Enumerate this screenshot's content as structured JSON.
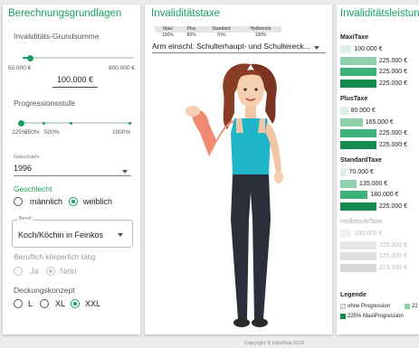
{
  "left": {
    "title": "Berechnungsgrundlagen",
    "sum_label": "Invaliditäts-Grundsumme",
    "sum_min": "50.000 €",
    "sum_max": "800.000 €",
    "sum_value": "100.000 €",
    "sum_fraction": 0.067,
    "prog_label": "Progressionsstufe",
    "prog_ticks": [
      "225%",
      "350%",
      "500%",
      "1000%"
    ],
    "prog_fraction": 0.0,
    "birth_label": "Geburtsjahr",
    "birth_value": "1996",
    "gender_head": "Geschlecht",
    "gender_male": "männlich",
    "gender_female": "weiblich",
    "job_label": "Beruf",
    "job_value": "Koch/Köchin in Feinkos",
    "physical_label": "Beruflich körperlich tätig",
    "physical_yes": "Ja",
    "physical_no": "Nein",
    "concept_label": "Deckungskonzept",
    "concept_l": "L",
    "concept_xl": "XL",
    "concept_xxl": "XXL"
  },
  "mid": {
    "title": "Invaliditätstaxe",
    "table_headers": [
      "Maxi",
      "Plus",
      "Standard",
      "Heilberufe"
    ],
    "table_values": [
      "100%",
      "80%",
      "70%",
      "100%"
    ],
    "select_value": "Arm einschl. Schulterhaupt- und Schultereck..."
  },
  "right": {
    "title": "Invaliditätsleistung",
    "groups": [
      {
        "name": "MaxiTaxe",
        "disabled": false,
        "bars": [
          {
            "label": "100.000 €",
            "fraction": 0.13,
            "color": "#dcf0e4"
          },
          {
            "label": "225.000 €",
            "fraction": 0.42,
            "color": "#8fd1ad"
          },
          {
            "label": "225.000 €",
            "fraction": 0.42,
            "color": "#3bb37a"
          },
          {
            "label": "225.000 €",
            "fraction": 0.42,
            "color": "#138a4e"
          }
        ]
      },
      {
        "name": "PlusTaxe",
        "disabled": false,
        "bars": [
          {
            "label": "80.000 €",
            "fraction": 0.09,
            "color": "#dcf0e4"
          },
          {
            "label": "165.000 €",
            "fraction": 0.26,
            "color": "#8fd1ad"
          },
          {
            "label": "225.000 €",
            "fraction": 0.42,
            "color": "#3bb37a"
          },
          {
            "label": "225.000 €",
            "fraction": 0.42,
            "color": "#138a4e"
          }
        ]
      },
      {
        "name": "StandardTaxe",
        "disabled": false,
        "bars": [
          {
            "label": "70.000 €",
            "fraction": 0.07,
            "color": "#dcf0e4"
          },
          {
            "label": "135.000 €",
            "fraction": 0.19,
            "color": "#8fd1ad"
          },
          {
            "label": "180.000 €",
            "fraction": 0.32,
            "color": "#3bb37a"
          },
          {
            "label": "225.000 €",
            "fraction": 0.42,
            "color": "#138a4e"
          }
        ]
      },
      {
        "name": "HeilberufeTaxe",
        "disabled": true,
        "bars": [
          {
            "label": "100.000 €",
            "fraction": 0.13,
            "color": "#f0f0f0"
          },
          {
            "label": "225.000 €",
            "fraction": 0.42,
            "color": "#e6e6e6"
          },
          {
            "label": "225.000 €",
            "fraction": 0.42,
            "color": "#dedede"
          },
          {
            "label": "225.000 €",
            "fraction": 0.42,
            "color": "#d6d6d6"
          }
        ]
      }
    ],
    "legend_head": "Legende",
    "legend_items": [
      {
        "label": "ohne Progression",
        "color": "#dcf0e4"
      },
      {
        "label": "22",
        "color": "#8fd1ad"
      },
      {
        "label": "225% MaxiProgression",
        "color": "#138a4e"
      }
    ]
  },
  "footer": "Copyright © InterRisk 2020"
}
